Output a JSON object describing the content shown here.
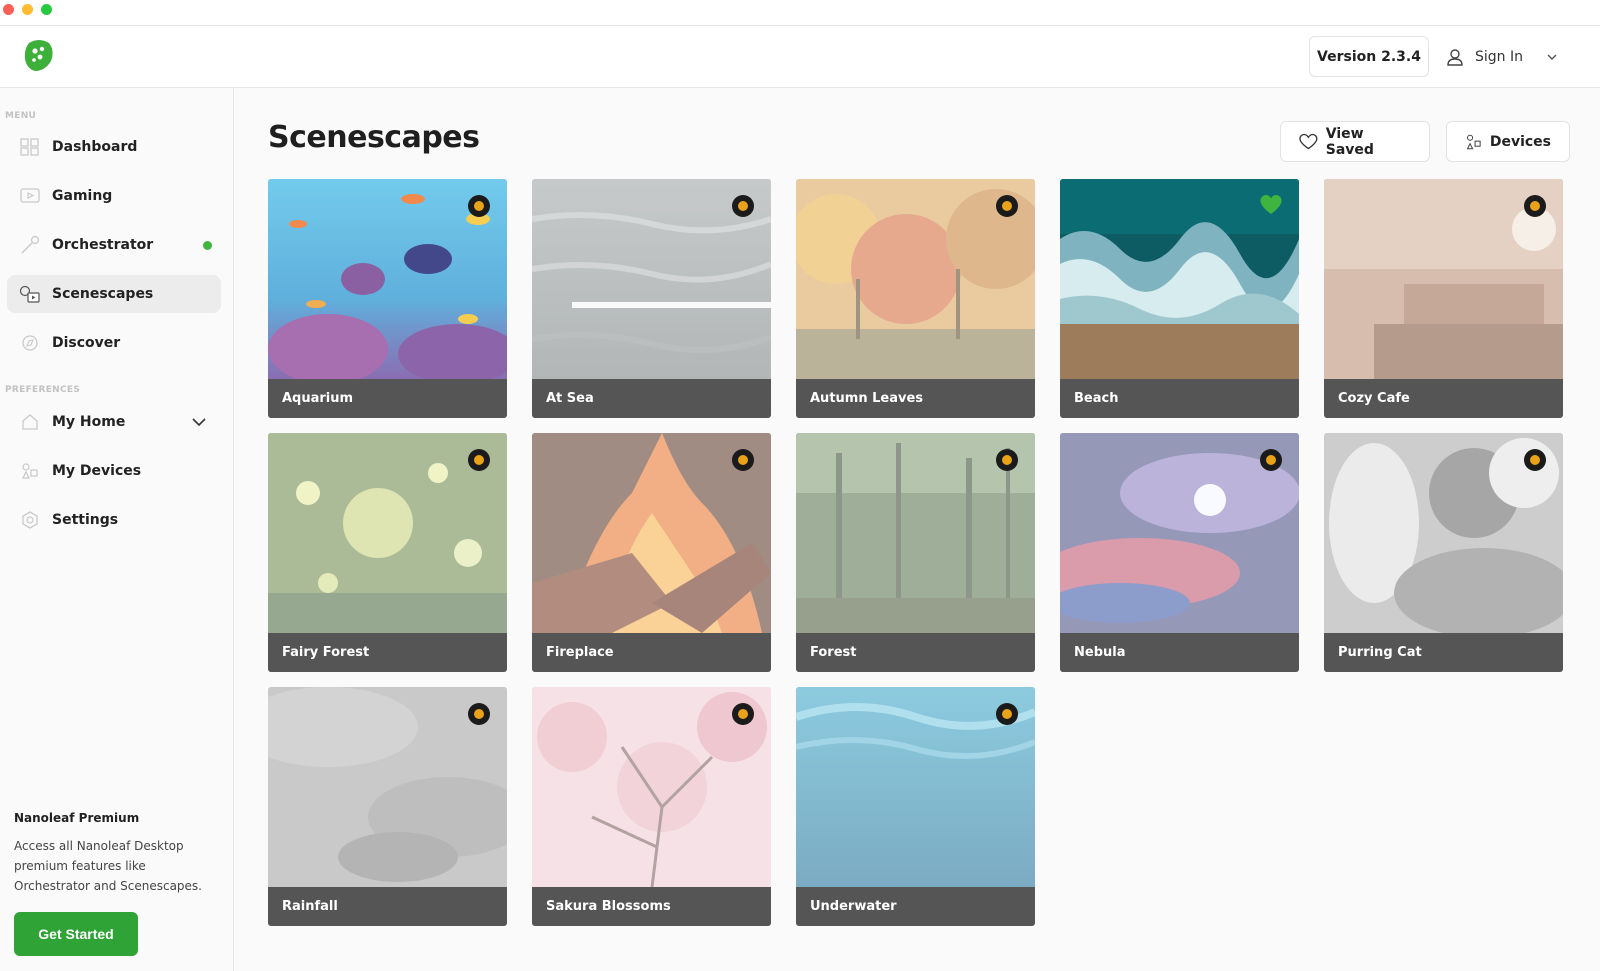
{
  "header": {
    "version_label": "Version 2.3.4",
    "signin_label": "Sign In"
  },
  "sidebar": {
    "menu_section": "MENU",
    "preferences_section": "PREFERENCES",
    "items": [
      {
        "label": "Dashboard",
        "icon": "dashboard-icon"
      },
      {
        "label": "Gaming",
        "icon": "gaming-icon"
      },
      {
        "label": "Orchestrator",
        "icon": "orchestrator-icon",
        "status_dot": true
      },
      {
        "label": "Scenescapes",
        "icon": "scenescapes-icon",
        "active": true
      },
      {
        "label": "Discover",
        "icon": "discover-icon"
      }
    ],
    "pref_items": [
      {
        "label": "My Home",
        "icon": "home-icon",
        "expandable": true
      },
      {
        "label": "My Devices",
        "icon": "devices-icon"
      },
      {
        "label": "Settings",
        "icon": "settings-icon"
      }
    ],
    "premium": {
      "title": "Nanoleaf Premium",
      "description": "Access all Nanoleaf Desktop premium features like Orchestrator and Scenescapes.",
      "cta_label": "Get Started"
    }
  },
  "main": {
    "title": "Scenescapes",
    "view_saved_label": "View Saved",
    "devices_label": "Devices",
    "scenes": [
      {
        "name": "Aquarium",
        "locked": true,
        "saved": false
      },
      {
        "name": "At Sea",
        "locked": true,
        "saved": false
      },
      {
        "name": "Autumn Leaves",
        "locked": true,
        "saved": false
      },
      {
        "name": "Beach",
        "locked": false,
        "saved": true
      },
      {
        "name": "Cozy Cafe",
        "locked": true,
        "saved": false
      },
      {
        "name": "Fairy Forest",
        "locked": true,
        "saved": false
      },
      {
        "name": "Fireplace",
        "locked": true,
        "saved": false
      },
      {
        "name": "Forest",
        "locked": true,
        "saved": false
      },
      {
        "name": "Nebula",
        "locked": true,
        "saved": false
      },
      {
        "name": "Purring Cat",
        "locked": true,
        "saved": false
      },
      {
        "name": "Rainfall",
        "locked": true,
        "saved": false
      },
      {
        "name": "Sakura Blossoms",
        "locked": true,
        "saved": false
      },
      {
        "name": "Underwater",
        "locked": true,
        "saved": false
      }
    ]
  },
  "colors": {
    "accent": "#2fa336",
    "status_online": "#3fb53f",
    "lock_badge": "#e8a318",
    "caption_bg": "#555555"
  }
}
